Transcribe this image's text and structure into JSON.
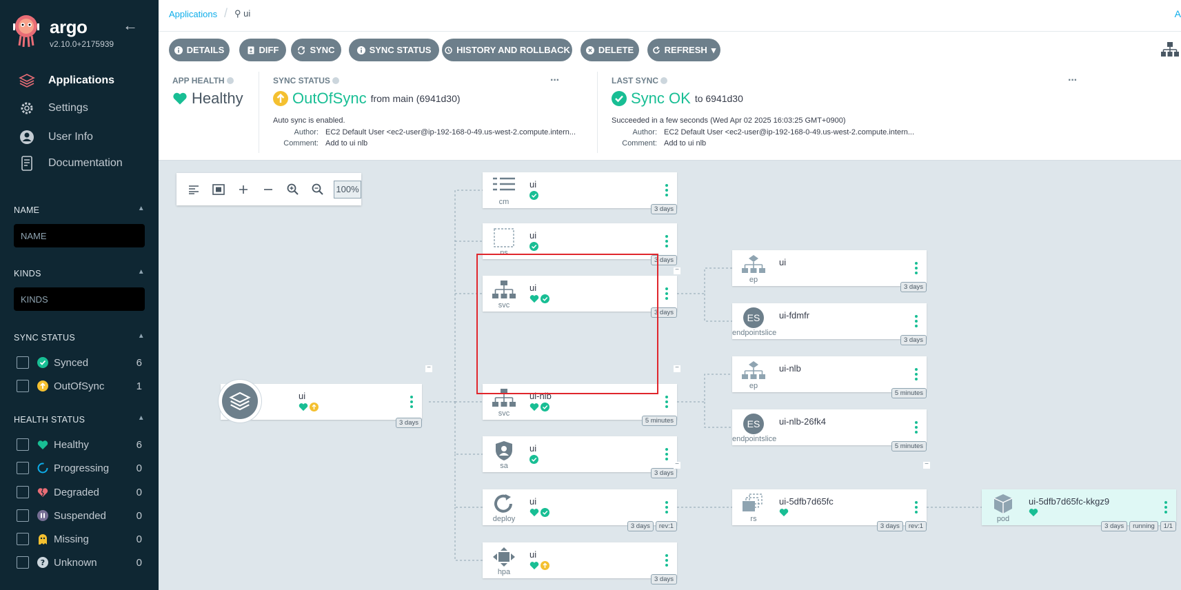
{
  "sidebar": {
    "brand": "argo",
    "version": "v2.10.0+2175939",
    "nav": [
      {
        "label": "Applications",
        "icon": "layers-icon"
      },
      {
        "label": "Settings",
        "icon": "gear-icon"
      },
      {
        "label": "User Info",
        "icon": "user-icon"
      },
      {
        "label": "Documentation",
        "icon": "docs-icon"
      }
    ],
    "name_filter": {
      "heading": "NAME",
      "placeholder": "NAME"
    },
    "kinds_filter": {
      "heading": "KINDS",
      "placeholder": "KINDS"
    },
    "sync_status": {
      "heading": "SYNC STATUS",
      "items": [
        {
          "label": "Synced",
          "count": "6"
        },
        {
          "label": "OutOfSync",
          "count": "1"
        }
      ]
    },
    "health_status": {
      "heading": "HEALTH STATUS",
      "items": [
        {
          "label": "Healthy",
          "count": "6"
        },
        {
          "label": "Progressing",
          "count": "0"
        },
        {
          "label": "Degraded",
          "count": "0"
        },
        {
          "label": "Suspended",
          "count": "0"
        },
        {
          "label": "Missing",
          "count": "0"
        },
        {
          "label": "Unknown",
          "count": "0"
        }
      ]
    }
  },
  "topbar": {
    "breadcrumb_root": "Applications",
    "breadcrumb_current": "ui",
    "right_text": "A"
  },
  "toolbar": {
    "details": "DETAILS",
    "diff": "DIFF",
    "sync": "SYNC",
    "sync_status": "SYNC STATUS",
    "history": "HISTORY AND ROLLBACK",
    "delete": "DELETE",
    "refresh": "REFRESH"
  },
  "status": {
    "app_health": {
      "heading": "APP HEALTH",
      "value": "Healthy"
    },
    "sync_status": {
      "heading": "SYNC STATUS",
      "value": "OutOfSync",
      "from": "from main (6941d30)",
      "auto": "Auto sync is enabled.",
      "author_label": "Author:",
      "author": "EC2 Default User <ec2-user@ip-192-168-0-49.us-west-2.compute.intern...",
      "comment_label": "Comment:",
      "comment": "Add to ui nlb"
    },
    "last_sync": {
      "heading": "LAST SYNC",
      "value": "Sync OK",
      "to": "to 6941d30",
      "result": "Succeeded in a few seconds (Wed Apr 02 2025 16:03:25 GMT+0900)",
      "author_label": "Author:",
      "author": "EC2 Default User <ec2-user@ip-192-168-0-49.us-west-2.compute.intern...",
      "comment_label": "Comment:",
      "comment": "Add to ui nlb"
    }
  },
  "graph": {
    "zoom": "100%",
    "root": {
      "name": "ui",
      "age": "3 days"
    },
    "nodes": [
      {
        "name": "ui",
        "kind": "cm",
        "tags": [
          "3 days"
        ]
      },
      {
        "name": "ui",
        "kind": "ns",
        "tags": [
          "3 days"
        ]
      },
      {
        "name": "ui",
        "kind": "svc",
        "tags": [
          "3 days"
        ]
      },
      {
        "name": "ui-nlb",
        "kind": "svc",
        "tags": [
          "5 minutes"
        ]
      },
      {
        "name": "ui",
        "kind": "sa",
        "tags": [
          "3 days"
        ]
      },
      {
        "name": "ui",
        "kind": "deploy",
        "tags": [
          "3 days",
          "rev:1"
        ]
      },
      {
        "name": "ui",
        "kind": "hpa",
        "tags": [
          "3 days"
        ]
      },
      {
        "name": "ui",
        "kind": "ep",
        "tags": [
          "3 days"
        ]
      },
      {
        "name": "ui-fdmfr",
        "kind": "endpointslice",
        "tags": [
          "3 days"
        ],
        "badge": "ES"
      },
      {
        "name": "ui-nlb",
        "kind": "ep",
        "tags": [
          "5 minutes"
        ]
      },
      {
        "name": "ui-nlb-26fk4",
        "kind": "endpointslice",
        "tags": [
          "5 minutes"
        ],
        "badge": "ES"
      },
      {
        "name": "ui-5dfb7d65fc",
        "kind": "rs",
        "tags": [
          "3 days",
          "rev:1"
        ]
      },
      {
        "name": "ui-5dfb7d65fc-kkgz9",
        "kind": "pod",
        "tags": [
          "3 days",
          "running",
          "1/1"
        ]
      }
    ]
  },
  "colors": {
    "sidebar_bg": "#0f2733",
    "healthy": "#18be94",
    "out_of_sync": "#f4c030",
    "button": "#6d7f8b",
    "highlight": "#e0262c"
  }
}
